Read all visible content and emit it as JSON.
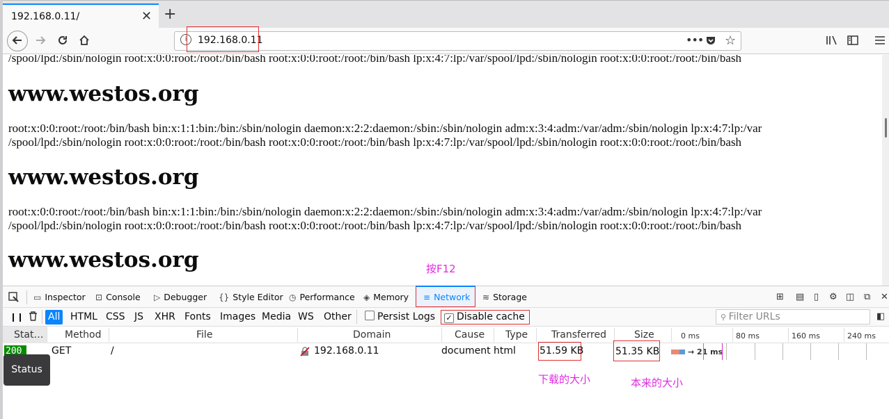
{
  "browser": {
    "tab_title": "192.168.0.11/",
    "tab_close": "✕",
    "new_tab": "+",
    "url": "192.168.0.11",
    "url_info_icon": "i",
    "page_actions": "•••"
  },
  "page": {
    "line_top": "/spool/lpd:/sbin/nologin root:x:0:0:root:/root:/bin/bash root:x:0:0:root:/root:/bin/bash lp:x:4:7:lp:/var/spool/lpd:/sbin/nologin root:x:0:0:root:/root:/bin/bash",
    "heading": "www.westos.org",
    "para_line1": "root:x:0:0:root:/root:/bin/bash bin:x:1:1:bin:/bin:/sbin/nologin daemon:x:2:2:daemon:/sbin:/sbin/nologin adm:x:3:4:adm:/var/adm:/sbin/nologin lp:x:4:7:lp:/var",
    "para_line2": "/spool/lpd:/sbin/nologin root:x:0:0:root:/root:/bin/bash root:x:0:0:root:/root:/bin/bash lp:x:4:7:lp:/var/spool/lpd:/sbin/nologin root:x:0:0:root:/root:/bin/bash"
  },
  "annotations": {
    "press_f12": "按F12",
    "download_size": "下载的大小",
    "original_size": "本来的大小"
  },
  "devtools": {
    "tabs": [
      {
        "label": "Inspector",
        "icon": "inspector-icon"
      },
      {
        "label": "Console",
        "icon": "console-icon"
      },
      {
        "label": "Debugger",
        "icon": "debugger-icon"
      },
      {
        "label": "Style Editor",
        "icon": "style-editor-icon"
      },
      {
        "label": "Performance",
        "icon": "performance-icon"
      },
      {
        "label": "Memory",
        "icon": "memory-icon"
      },
      {
        "label": "Network",
        "icon": "network-icon"
      },
      {
        "label": "Storage",
        "icon": "storage-icon"
      }
    ],
    "selected_tab": "Network",
    "filters": [
      "All",
      "HTML",
      "CSS",
      "JS",
      "XHR",
      "Fonts",
      "Images",
      "Media",
      "WS",
      "Other"
    ],
    "persist_logs": "Persist Logs",
    "disable_cache": "Disable cache",
    "filter_placeholder": "Filter URLs",
    "columns": [
      "Stat…",
      "Method",
      "File",
      "Domain",
      "Cause",
      "Type",
      "Transferred",
      "Size"
    ],
    "timeline_ticks": [
      "0 ms",
      "80 ms",
      "160 ms",
      "240 ms"
    ],
    "request": {
      "status": "200",
      "method": "GET",
      "file": "/",
      "domain": "192.168.0.11",
      "cause": "document",
      "type": "html",
      "transferred": "51.59 KB",
      "size": "51.35 KB",
      "timing": "→ 21 ms"
    },
    "tooltip": "Status"
  }
}
